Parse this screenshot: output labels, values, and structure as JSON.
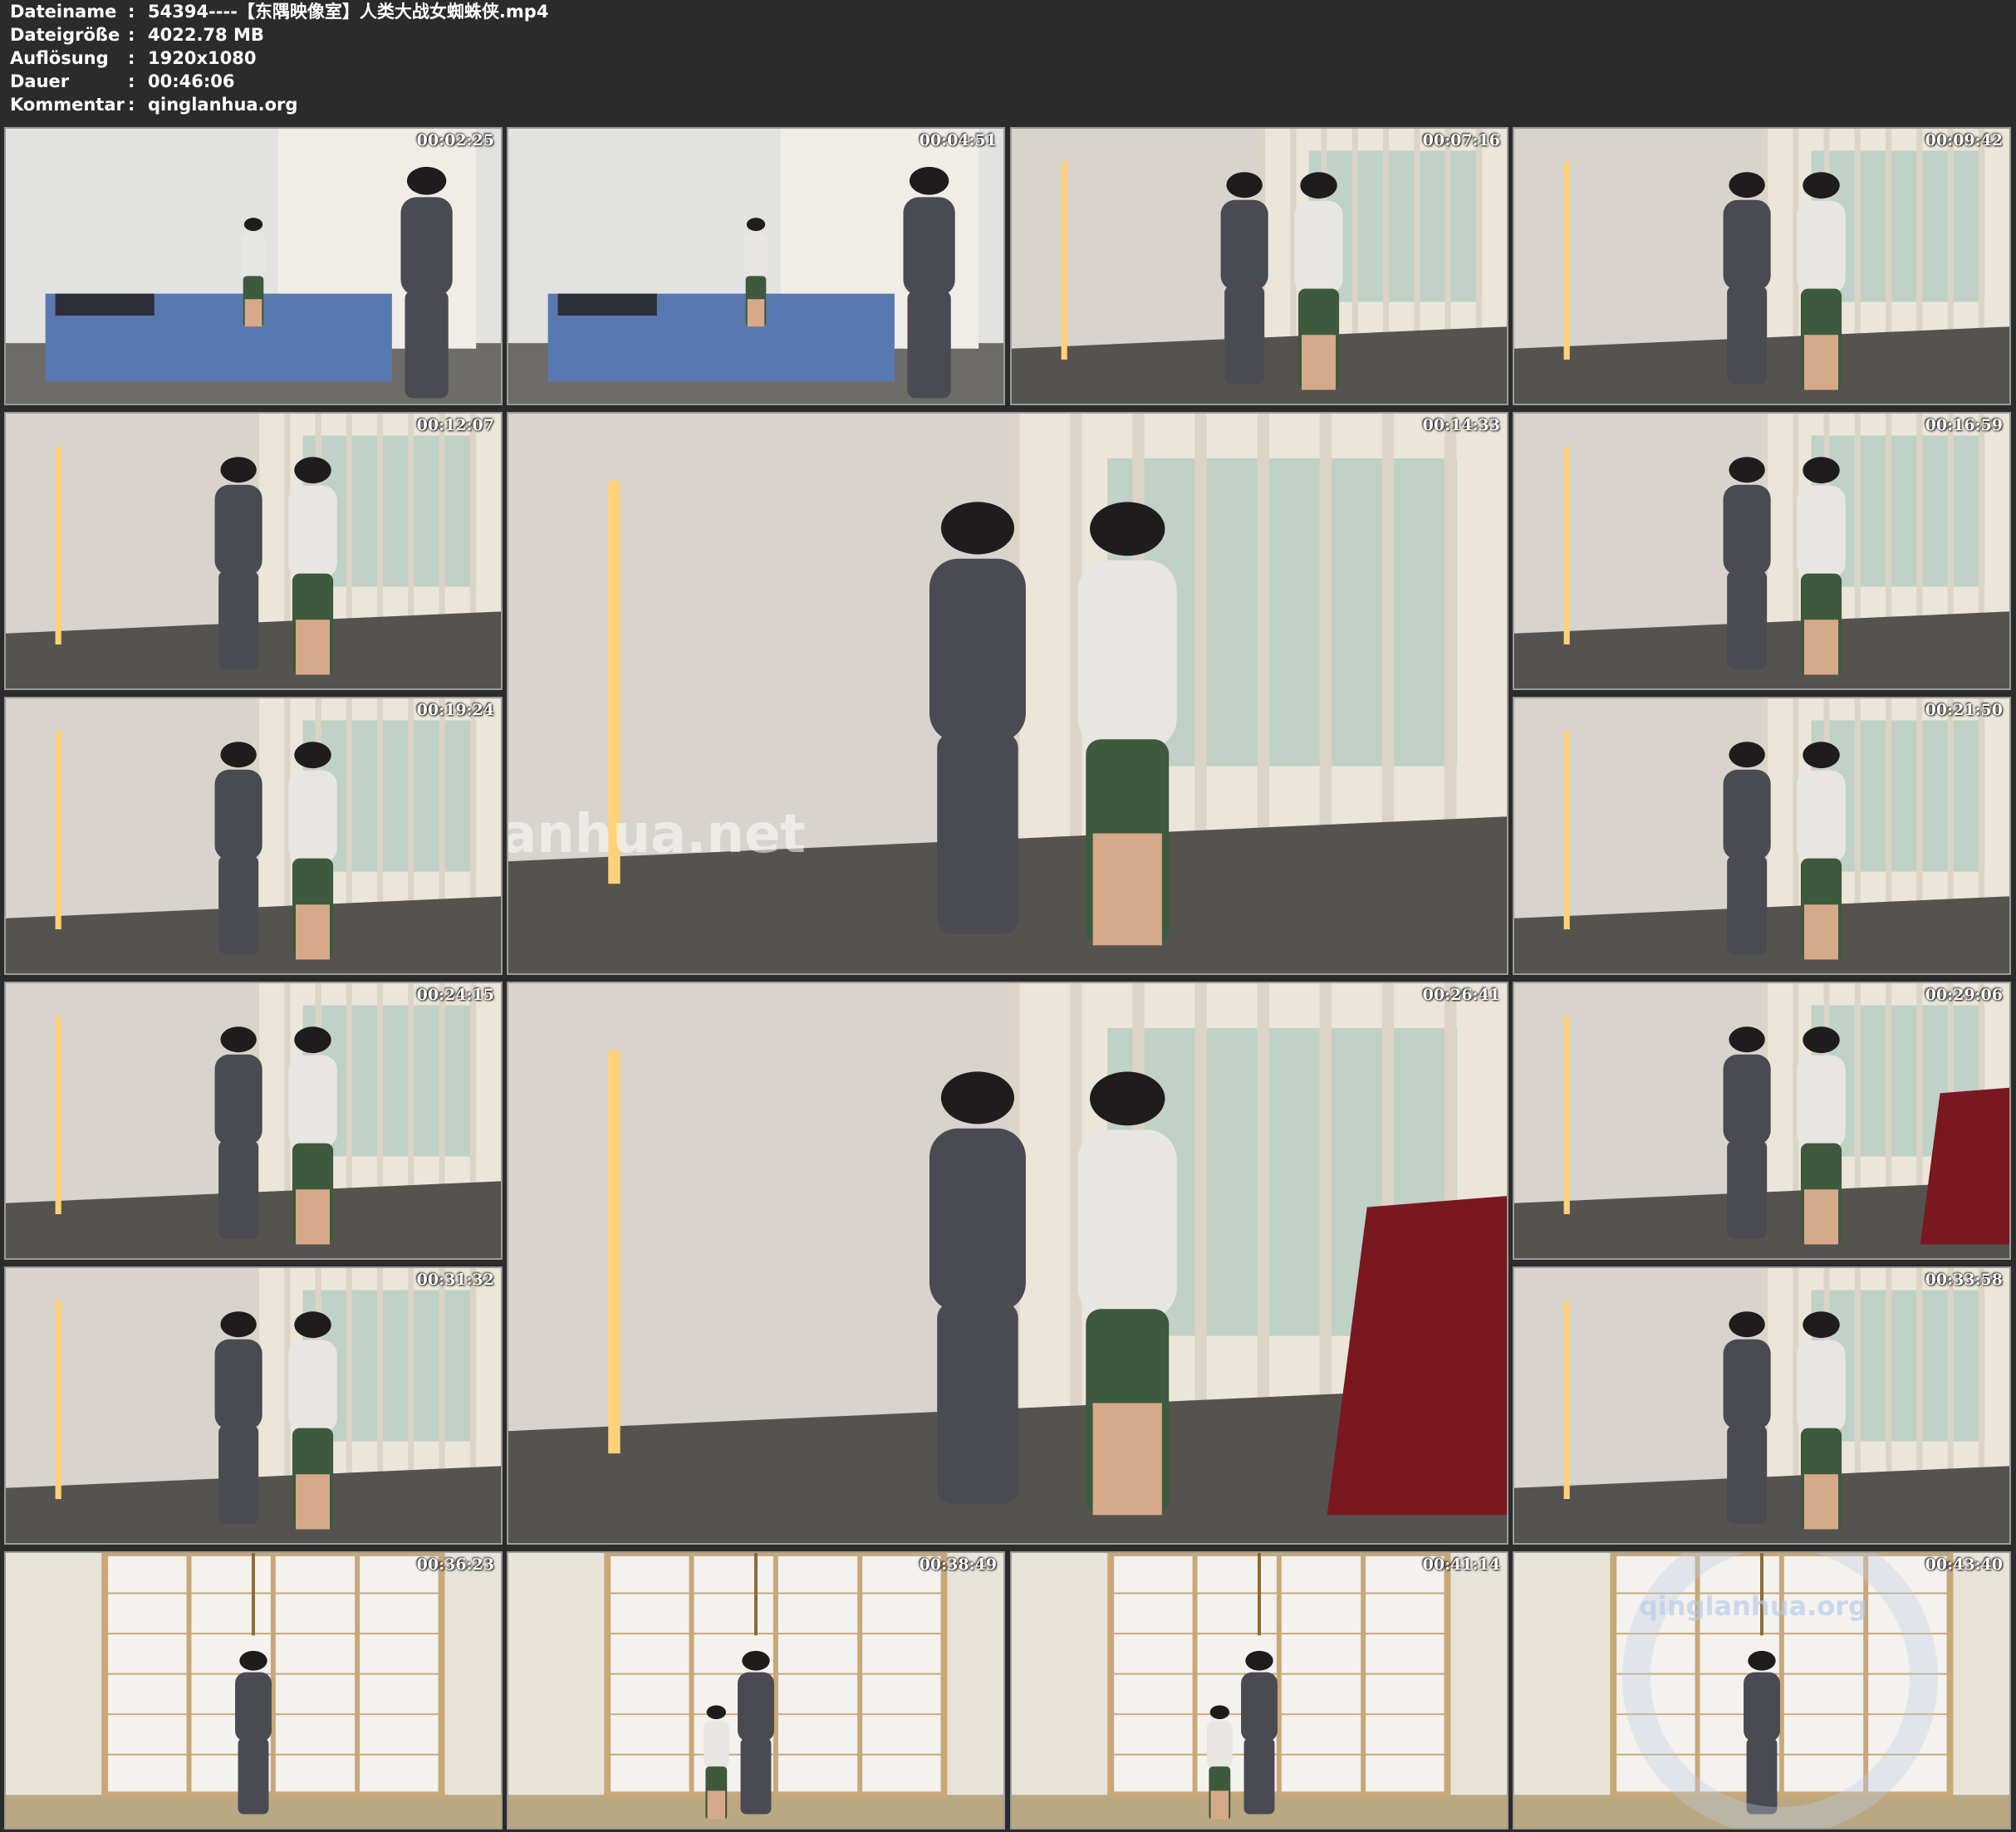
{
  "info": [
    {
      "label": "Dateiname",
      "value": "54394----【东隅映像室】人类大战女蜘蛛侠.mp4"
    },
    {
      "label": "Dateigröße",
      "value": "4022.78 MB"
    },
    {
      "label": "Auflösung",
      "value": "1920x1080"
    },
    {
      "label": "Dauer",
      "value": "00:46:06"
    },
    {
      "label": "Kommentar",
      "value": "qinglanhua.org"
    }
  ],
  "info_separator": ":",
  "timestamps": [
    "00:02:25",
    "00:04:51",
    "00:07:16",
    "00:09:42",
    "00:12:07",
    "00:14:33",
    "00:16:59",
    "00:19:24",
    "00:21:50",
    "00:24:15",
    "00:26:41",
    "00:29:06",
    "00:31:32",
    "00:33:58",
    "00:36:23",
    "00:38:49",
    "00:41:14",
    "00:43:40"
  ],
  "watermarks": {
    "center": "qinglanhua.net",
    "corner": "qinglanhua.org"
  },
  "colors": {
    "background": "#2b2b2b",
    "wall": "#d8d3cc",
    "floor": "#55534f",
    "curtain": "#ece6da",
    "window": "#9dbfb8",
    "lamp": "#ffd27a",
    "bed": "#5a78b0",
    "bodysuit": "#4a4a52",
    "shirt": "#e8e6e2",
    "shorts": "#3d5a3c",
    "red_cloth": "#7a1820",
    "shoji_frame": "#c8a878",
    "shoji_paper": "#f4f2ee"
  }
}
